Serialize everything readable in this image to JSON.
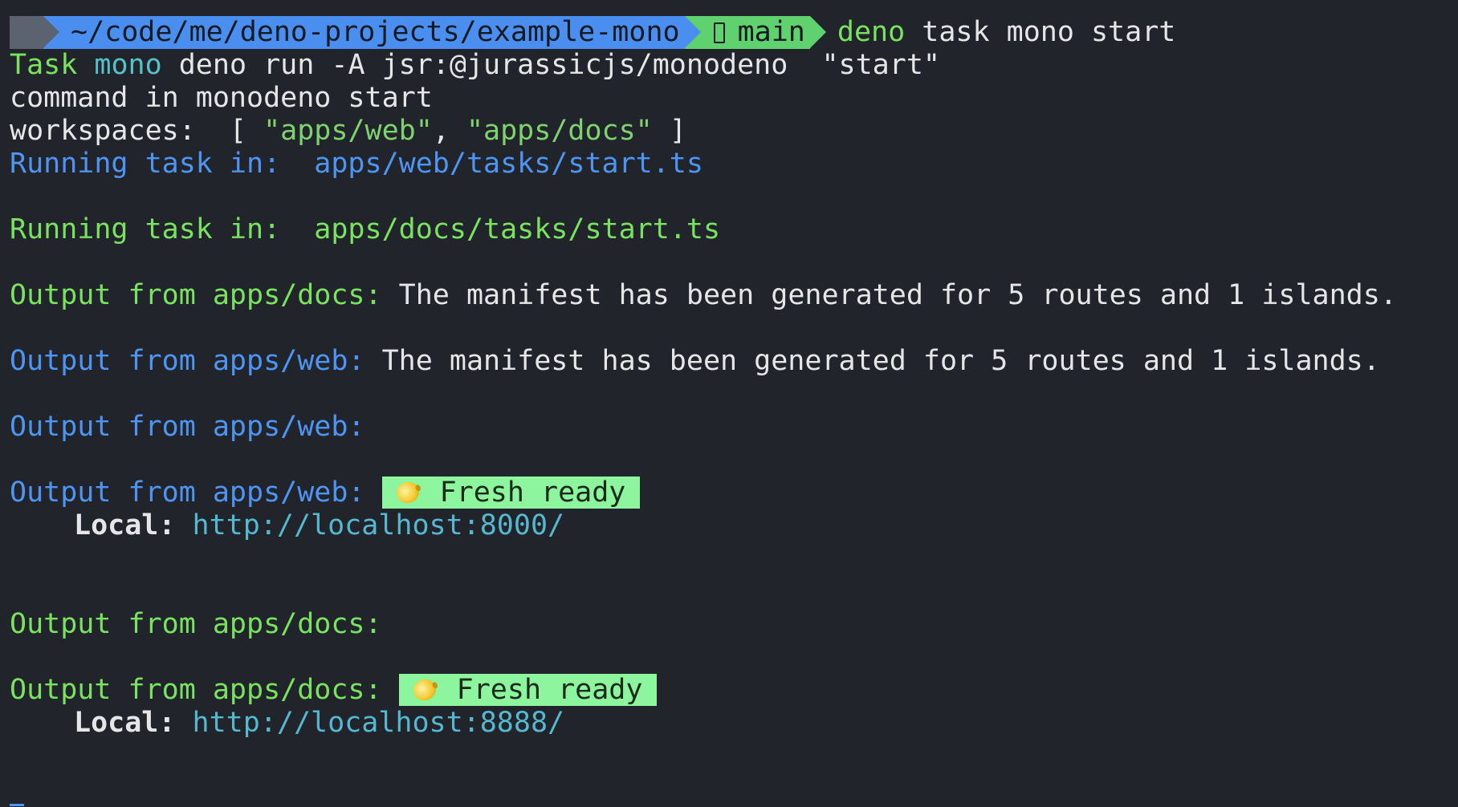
{
  "prompt": {
    "path": "~/code/me/deno-projects/example-mono",
    "branch": "main",
    "command_head": "deno",
    "command_rest": " task mono start"
  },
  "lines": {
    "task_label": "Task",
    "task_name": " mono",
    "task_cmd": " deno run -A jsr:@jurassicjs/monodeno  \"start\"",
    "command_in": "command in monodeno start",
    "ws_prefix": "workspaces:  [ ",
    "ws_item1": "\"apps/web\"",
    "ws_sep": ", ",
    "ws_item2": "\"apps/docs\"",
    "ws_suffix": " ]",
    "running_web": "Running task in:  apps/web/tasks/start.ts",
    "running_docs": "Running task in:  apps/docs/tasks/start.ts",
    "out_docs_prefix": "Output from apps/docs:",
    "out_docs_msg": " The manifest has been generated for 5 routes and 1 islands.",
    "out_web_prefix": "Output from apps/web:",
    "out_web_msg": " The manifest has been generated for 5 routes and 1 islands.",
    "out_web_empty": "Output from apps/web:",
    "out_web_ready_prefix": "Output from apps/web: ",
    "fresh_ready": "Fresh ready",
    "local_label": "Local:",
    "web_url": "http://localhost:8000/",
    "out_docs_empty": "Output from apps/docs:",
    "out_docs_ready_prefix": "Output from apps/docs: ",
    "docs_url": "http://localhost:8888/"
  },
  "icons": {
    "branch": "git-branch-icon",
    "lemon": "lemon-icon"
  },
  "colors": {
    "background": "#21242b",
    "path_segment": "#4a8ff0",
    "git_segment": "#5fd16f",
    "fresh_badge": "#8cf59d"
  }
}
